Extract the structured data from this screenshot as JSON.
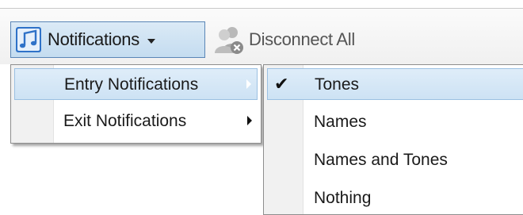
{
  "toolbar": {
    "notifications_label": "Notifications",
    "notifications_icon": "music-note-icon",
    "disconnect_label": "Disconnect All",
    "disconnect_icon": "disconnect-users-icon"
  },
  "notifications_menu": {
    "items": [
      {
        "label": "Entry Notifications",
        "has_submenu": true,
        "highlighted": true
      },
      {
        "label": "Exit Notifications",
        "has_submenu": true,
        "highlighted": false
      }
    ]
  },
  "entry_submenu": {
    "items": [
      {
        "label": "Tones",
        "checked": true,
        "highlighted": true
      },
      {
        "label": "Names",
        "checked": false
      },
      {
        "label": "Names and Tones",
        "checked": false
      },
      {
        "label": "Nothing",
        "checked": false
      }
    ],
    "check_glyph": "✔"
  },
  "colors": {
    "highlight": "#cde2f4",
    "highlight_border": "#9bc0e2",
    "button_border": "#5a86b6",
    "icon_blue": "#2f72c8"
  }
}
